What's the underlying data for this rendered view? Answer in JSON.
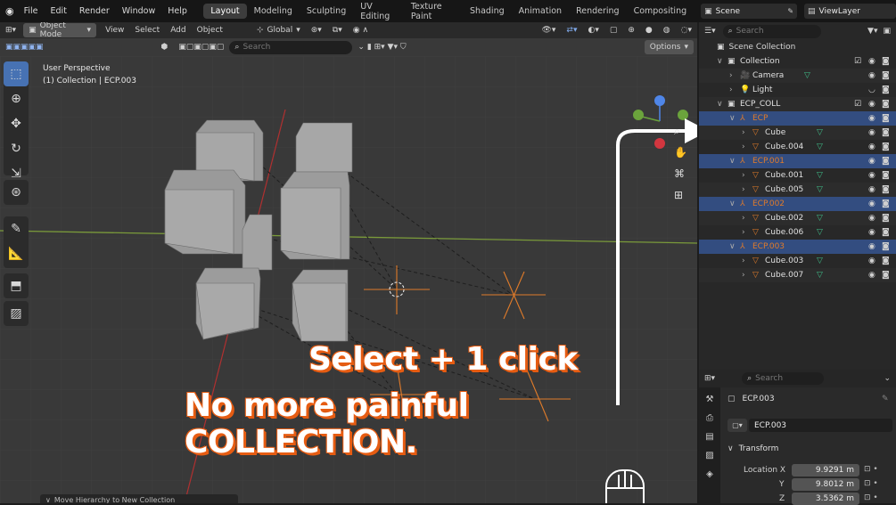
{
  "topbar": {
    "menus": [
      "File",
      "Edit",
      "Render",
      "Window",
      "Help"
    ],
    "workspaces": [
      "Layout",
      "Modeling",
      "Sculpting",
      "UV Editing",
      "Texture Paint",
      "Shading",
      "Animation",
      "Rendering",
      "Compositing"
    ],
    "active_workspace": "Layout",
    "scene": "Scene",
    "view_layer": "ViewLayer"
  },
  "viewport": {
    "mode": "Object Mode",
    "menus": [
      "View",
      "Select",
      "Add",
      "Object"
    ],
    "orientation": "Global",
    "search_placeholder": "Search",
    "options_label": "Options",
    "view_name": "User Perspective",
    "context": "(1) Collection | ECP.003",
    "status_hint": "Move Hierarchy to New Collection"
  },
  "caption": {
    "line1": "Select + 1 click",
    "line2": "No more painful COLLECTION."
  },
  "outliner": {
    "search_placeholder": "Search",
    "root": "Scene Collection",
    "rows": [
      {
        "label": "Collection",
        "type": "collection",
        "selected": false
      },
      {
        "label": "Camera",
        "type": "camera",
        "selected": false
      },
      {
        "label": "Light",
        "type": "light",
        "selected": false
      },
      {
        "label": "ECP_COLL",
        "type": "collection",
        "selected": false
      },
      {
        "label": "ECP",
        "type": "empty",
        "selected": true
      },
      {
        "label": "Cube",
        "type": "mesh",
        "selected": false
      },
      {
        "label": "Cube.004",
        "type": "mesh",
        "selected": false
      },
      {
        "label": "ECP.001",
        "type": "empty",
        "selected": true
      },
      {
        "label": "Cube.001",
        "type": "mesh",
        "selected": false
      },
      {
        "label": "Cube.005",
        "type": "mesh",
        "selected": false
      },
      {
        "label": "ECP.002",
        "type": "empty",
        "selected": true
      },
      {
        "label": "Cube.002",
        "type": "mesh",
        "selected": false
      },
      {
        "label": "Cube.006",
        "type": "mesh",
        "selected": false
      },
      {
        "label": "ECP.003",
        "type": "empty",
        "selected": true
      },
      {
        "label": "Cube.003",
        "type": "mesh",
        "selected": false
      },
      {
        "label": "Cube.007",
        "type": "mesh",
        "selected": false
      }
    ]
  },
  "properties": {
    "search_placeholder": "Search",
    "object_name": "ECP.003",
    "object_field": "ECP.003",
    "panel": "Transform",
    "location_label": "Location X",
    "y_label": "Y",
    "z_label": "Z",
    "loc_x": "9.9291 m",
    "loc_y": "9.8012 m",
    "loc_z": "3.5362 m"
  },
  "colors": {
    "accent": "#4772b3",
    "selection": "#334d80",
    "empty_orange": "#e07b2a",
    "mesh_green": "#3fbf8a",
    "caption_outline": "#e65c12"
  }
}
